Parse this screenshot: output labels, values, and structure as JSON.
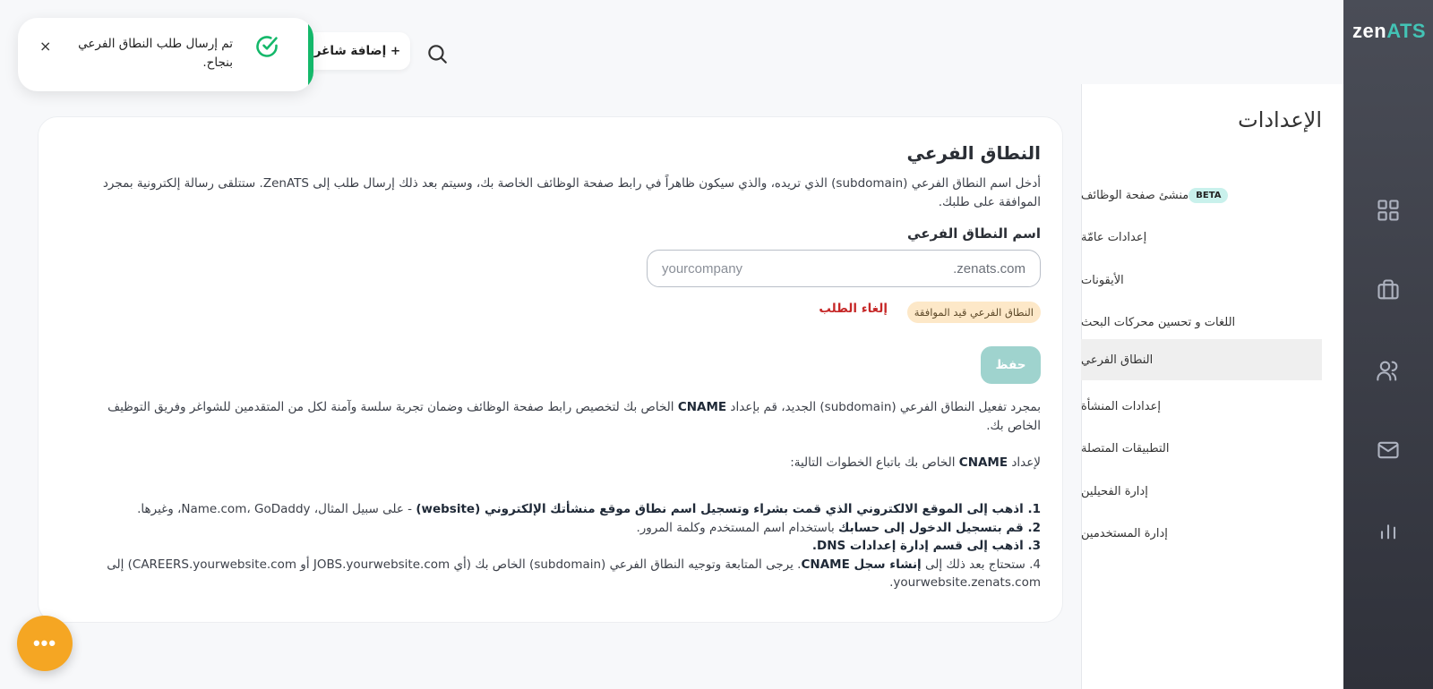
{
  "brand": {
    "logo_main": "zen",
    "logo_accent": "ATS",
    "accent_color": "#43c3b5"
  },
  "rail": {
    "icons": [
      "grid-icon",
      "briefcase-icon",
      "users-icon",
      "mail-icon",
      "bar-chart-icon"
    ]
  },
  "topbar": {
    "add_job_label": "+ إضافة شاغر"
  },
  "toast": {
    "message": "تم إرسال طلب النطاق الفرعي بنجاح.",
    "close": "×",
    "color": "#14b86a"
  },
  "sidebar": {
    "title": "الإعدادات",
    "items": [
      {
        "label": "منشئ صفحة الوظائف",
        "badge": "BETA"
      },
      {
        "label": "إعدادات عامّة"
      },
      {
        "label": "الأيقونات"
      },
      {
        "label": "اللغات و تحسين محركات البحث"
      },
      {
        "label": "النطاق الفرعي",
        "active": true
      },
      {
        "label": "إعدادات المنشأة"
      },
      {
        "label": "التطبيقات المتصلة"
      },
      {
        "label": "إدارة الفحيلين"
      },
      {
        "label": "إدارة المستخدمين"
      }
    ]
  },
  "main": {
    "title": "النطاق الفرعي",
    "description": "أدخل اسم النطاق الفرعي (subdomain) الذي تريده، والذي سيكون ظاهراً في رابط صفحة الوظائف الخاصة بك، وسيتم بعد ذلك إرسال طلب إلى ZenATS. ستتلقى رسالة إلكترونية بمجرد الموافقة على طلبك.",
    "field_label": "اسم النطاق الفرعي",
    "input_placeholder": "yourcompany",
    "input_suffix": ".zenats.com",
    "pending_badge": "النطاق الفرعي قيد الموافقة",
    "cancel_label": "إلغاء الطلب",
    "save_label": "حفظ",
    "para1_a": "بمجرد تفعيل النطاق الفرعي (subdomain) الجديد، قم بإعداد ",
    "para1_b": "CNAME",
    "para1_c": " الخاص بك لتخصيص رابط صفحة الوظائف وضمان تجربة سلسة وآمنة لكل من المتقدمين للشواغر وفريق التوظيف الخاص بك.",
    "para2_a": "لإعداد ",
    "para2_b": "CNAME",
    "para2_c": " الخاص بك باتباع الخطوات التالية:",
    "step1_bold": "1. اذهب إلى الموقع الالكتروني الذي قمت بشراء وتسجيل اسم نطاق موقع منشأتك الإلكتروني (website)",
    "step1_rest": " - على سبيل المثال، Name.com، GoDaddy، وغيرها.",
    "step2_bold": "2. قم بتسجيل الدخول إلى حسابك",
    "step2_rest": " باستخدام اسم المستخدم وكلمة المرور.",
    "step3_bold": "3. اذهب إلى قسم إدارة إعدادات DNS.",
    "step4_a": "4. ستحتاج بعد ذلك إلى ",
    "step4_b": "إنشاء سجل CNAME",
    "step4_c": ". يرجى المتابعة وتوجيه النطاق الفرعي (subdomain) الخاص بك (أي JOBS.yourwebsite.com أو CAREERS.yourwebsite.com) إلى yourwebsite.zenats.com."
  },
  "fab": {
    "label": "•••",
    "color": "#f5a623"
  }
}
